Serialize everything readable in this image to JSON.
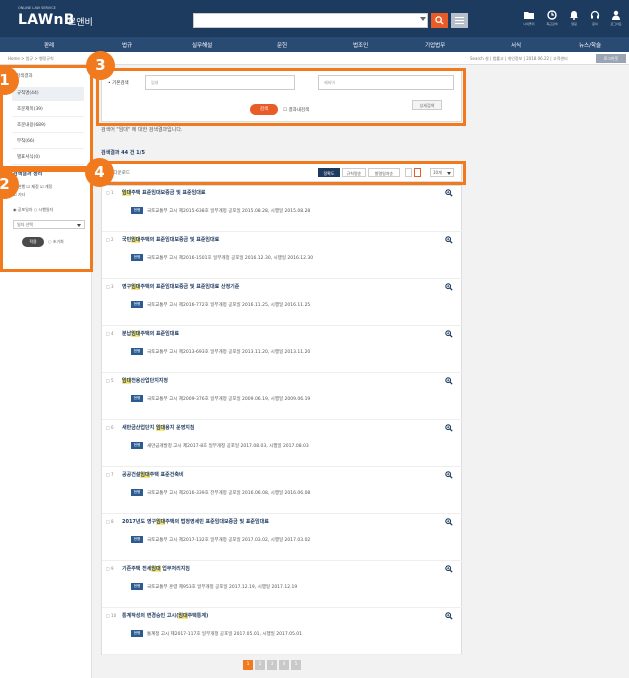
{
  "header": {
    "logo_small": "ONLINE LAW SERVICE",
    "logo": "LAWnB",
    "logo_sub": "로앤비",
    "utils": [
      "나의폴더",
      "최근검색",
      "알림",
      "문의",
      "로그아웃"
    ]
  },
  "nav": {
    "items": [
      "판례",
      "법규",
      "실무해설",
      "문헌",
      "법조인",
      "기업법무",
      "서식",
      "뉴스/학술"
    ]
  },
  "breadcrumb": {
    "path": "Home > 법규 > 행정규칙",
    "right": "Search 설 | 법률고 | 개인정보 | 2018.06.22 | 고객센터",
    "button": "로그아웃"
  },
  "sidebar": {
    "heading": "검색결과",
    "items": [
      {
        "label": "규칙명(44)",
        "active": true
      },
      {
        "label": "조문제목(39)",
        "active": false
      },
      {
        "label": "조문내용(689)",
        "active": false
      },
      {
        "label": "부칙(66)",
        "active": false
      },
      {
        "label": "별표서식(0)",
        "active": false
      }
    ],
    "filter_title": "검색결과 정리",
    "filter_row1": "☑ 현행 ☑ 제정 ☑ 개정",
    "filter_row2": "☑ 기타",
    "filter_row3": "◉ 공포일자 ○ 시행일자",
    "filter_select": "일자 선택",
    "apply_label": "적용",
    "reset_label": "○ 초기화"
  },
  "search": {
    "label": "• 기본검색",
    "input1_placeholder": "임대",
    "input2_placeholder": "제외어",
    "search_button": "검색",
    "within_label": "☐ 결과내검색",
    "detail_button": "상세검색",
    "result_message": "검색어 \"임대\" 에 대한 검색결과입니다.",
    "result_count": "검색결과 44 건 1/5"
  },
  "toolbar": {
    "check_label": "☐ 다운로드",
    "sort_buttons": [
      "정확도",
      "규칙명순",
      "발령일자순"
    ],
    "per_page": "10개"
  },
  "results": [
    {
      "num": "□ 1",
      "title_pre": "",
      "title_hl": "임대",
      "title_post": "주택 표준임대보증금 및 표준임대료",
      "badge": "현행",
      "meta": "국토교통부 고시 제2015-638호 일부개정 공포일 2015.08.28, 시행일 2015.08.28"
    },
    {
      "num": "□ 2",
      "title_pre": "국민",
      "title_hl": "임대",
      "title_post": "주택의 표준임대보증금 및 표준임대료",
      "badge": "현행",
      "meta": "국토교통부 고시 제2016-1501호 일부개정 공포일 2016.12.30, 시행일 2016.12.30"
    },
    {
      "num": "□ 3",
      "title_pre": "영구",
      "title_hl": "임대",
      "title_post": "주택의 표준임대보증금 및 표준임대료 산정기준",
      "badge": "현행",
      "meta": "국토교통부 고시 제2016-772호 일부개정 공포일 2016.11.25, 시행일 2016.11.25"
    },
    {
      "num": "□ 4",
      "title_pre": "분납",
      "title_hl": "임대",
      "title_post": "주택의 표준임대료",
      "badge": "현행",
      "meta": "국토교통부 고시 제2013-693호 일부개정 공포일 2013.11.20, 시행일 2013.11.20"
    },
    {
      "num": "□ 5",
      "title_pre": "",
      "title_hl": "임대",
      "title_post": "전용산업단지지정",
      "badge": "현행",
      "meta": "국토교통부 고시 제2009-376호 일부개정 공포일 2009.06.19, 시행일 2009.06.19"
    },
    {
      "num": "□ 6",
      "title_pre": "새만금산업단지 ",
      "title_hl": "임대",
      "title_post": "용지 운영지침",
      "badge": "현행",
      "meta": "새만금개발청 고시 제2017-8호 일부개정 공포일 2017.08.03, 시행일 2017.08.03"
    },
    {
      "num": "□ 7",
      "title_pre": "공공건설",
      "title_hl": "임대",
      "title_post": "주택 표준건축비",
      "badge": "현행",
      "meta": "국토교통부 고시 제2016-339호 전부개정 공포일 2016.06.08, 시행일 2016.06.08"
    },
    {
      "num": "□ 8",
      "title_pre": "2017년도 영구",
      "title_hl": "임대",
      "title_post": "주택의 법정영세민 표준임대보증금 및 표준임대료",
      "badge": "현행",
      "meta": "국토교통부 고시 제2017-132호 일부개정 공포일 2017.03.02, 시행일 2017.03.02"
    },
    {
      "num": "□ 9",
      "title_pre": "기존주택 전세",
      "title_hl": "임대",
      "title_post": " 업무처리지침",
      "badge": "현행",
      "meta": "국토교통부 훈령 제953호 일부개정 공포일 2017.12.19, 시행일 2017.12.19"
    },
    {
      "num": "□ 10",
      "title_pre": "통계작성의 변경승인 고시(",
      "title_hl": "임대",
      "title_post": "주택통계)",
      "badge": "현행",
      "meta": "통계청 고시 제2017-117호 일부개정 공포일 2017.05.01, 시행일 2017.05.01"
    }
  ],
  "pagination": [
    "1",
    "2",
    "3",
    "4",
    "5"
  ],
  "annotations": [
    "1",
    "2",
    "3",
    "4"
  ],
  "colors": {
    "accent": "#f27a1e",
    "brand": "#1d3a5f",
    "highlight": "#f7e47a"
  }
}
